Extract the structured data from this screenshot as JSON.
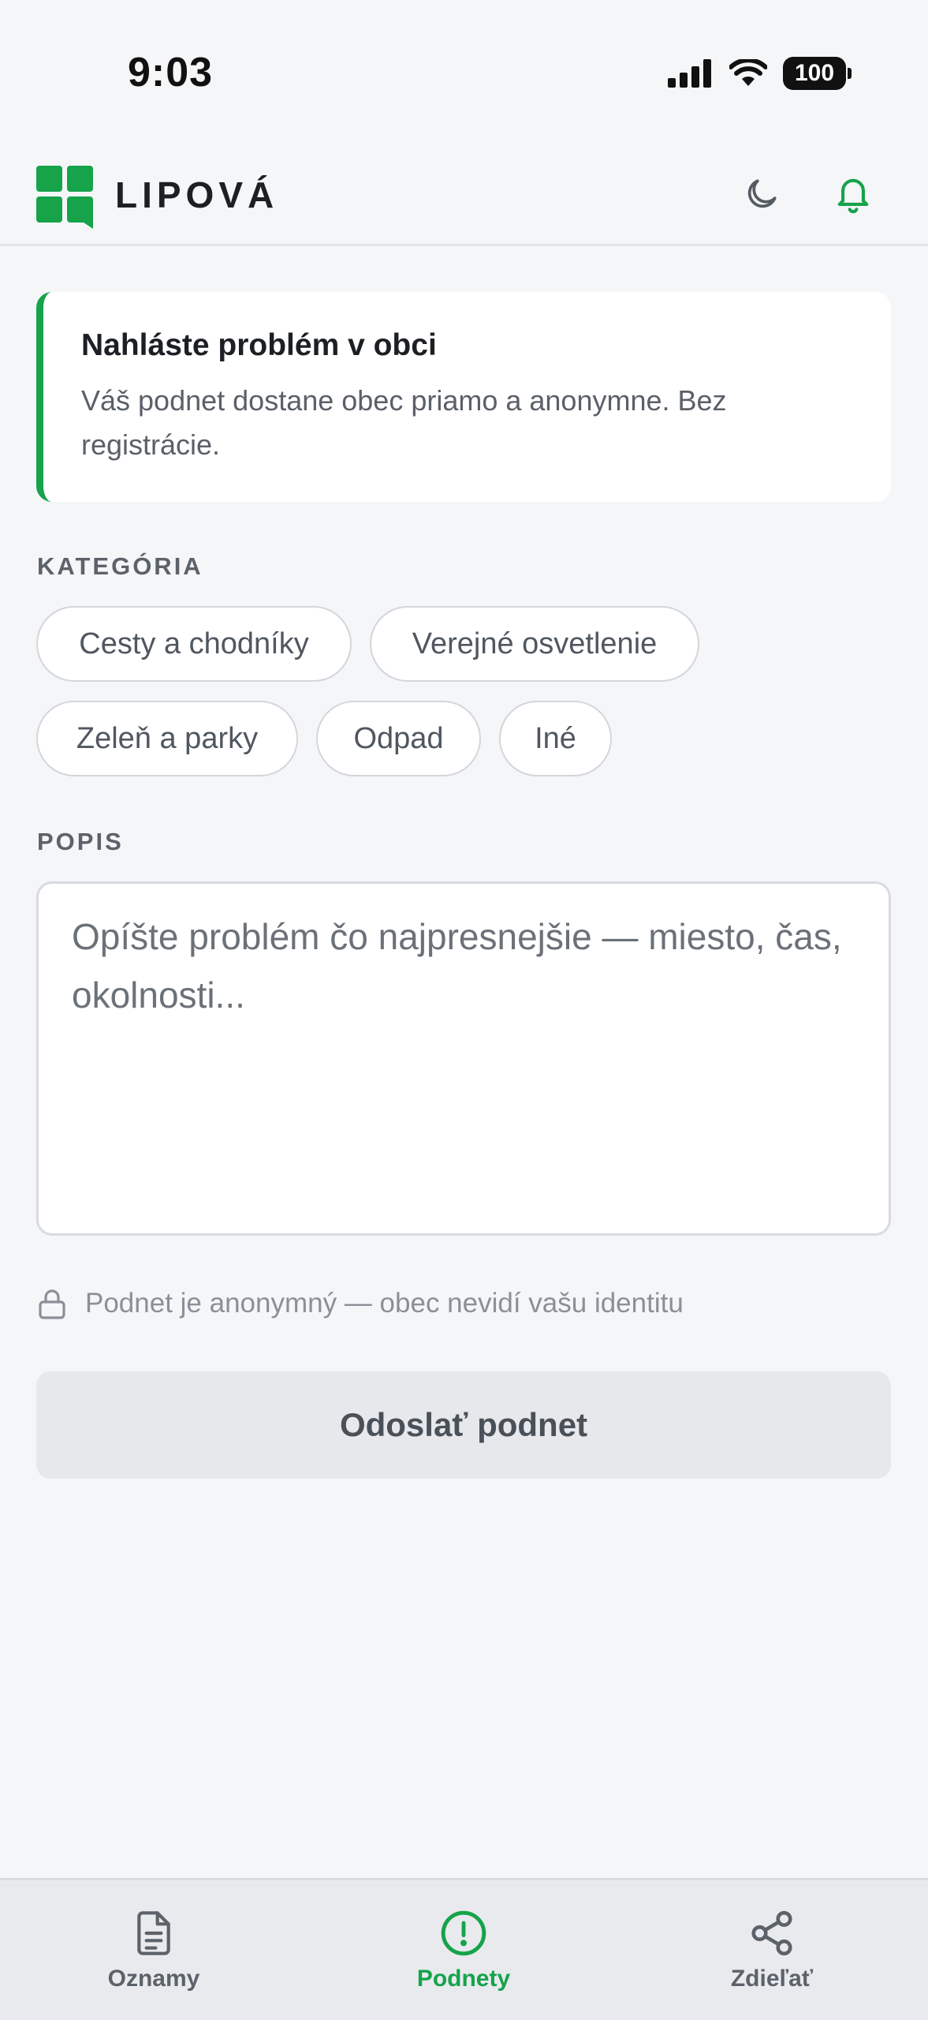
{
  "status_bar": {
    "time": "9:03",
    "battery": "100"
  },
  "header": {
    "brand": "LIPOVÁ",
    "theme_icon": "moon-icon",
    "notification_icon": "bell-icon"
  },
  "info_card": {
    "title": "Nahláste problém v obci",
    "text": "Váš podnet dostane obec priamo a anonymne. Bez registrácie."
  },
  "category": {
    "label": "KATEGÓRIA",
    "chips": [
      "Cesty a chodníky",
      "Verejné osvetlenie",
      "Zeleň a parky",
      "Odpad",
      "Iné"
    ]
  },
  "description": {
    "label": "POPIS",
    "placeholder": "Opíšte problém čo najpresnejšie — miesto, čas, okolnosti..."
  },
  "anon_note": "Podnet je anonymný — obec nevidí vašu identitu",
  "submit_label": "Odoslať podnet",
  "bottom_nav": {
    "items": [
      {
        "label": "Oznamy",
        "icon": "document-icon"
      },
      {
        "label": "Podnety",
        "icon": "alert-circle-icon",
        "active": true
      },
      {
        "label": "Zdieľať",
        "icon": "share-icon"
      }
    ]
  },
  "colors": {
    "accent": "#16a34a",
    "background": "#f5f6f8"
  }
}
